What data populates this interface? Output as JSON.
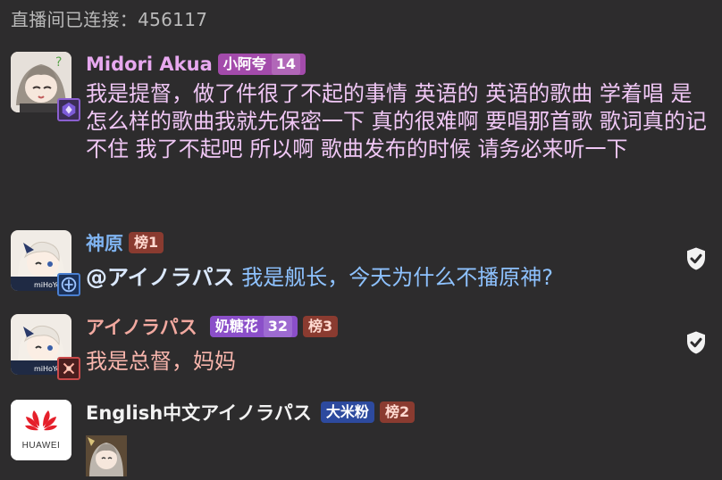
{
  "header": {
    "connected": "直播间已连接：456117"
  },
  "messages": [
    {
      "username": "Midori Akua",
      "badges": [
        {
          "label": "小阿夸",
          "level": "14"
        }
      ],
      "text": "我是提督，做了件很了不起的事情 英语的 英语的歌曲 学着唱 是怎么样的歌曲我就先保密一下 真的很难啊 要唱那首歌 歌词真的记不住 我了不起吧 所以啊 歌曲发布的时候 请务必来听一下",
      "colors": {
        "name": "#e7a8ef",
        "text": "#f0c7f5",
        "badge": "#a34bab"
      },
      "avatar": "anime-girl-avatar"
    },
    {
      "username": "神原",
      "badges": [
        {
          "label": "榜1"
        }
      ],
      "mention": "@アイノラパス",
      "text": "我是舰长，今天为什么不播原神?",
      "colors": {
        "name": "#7fb3f0",
        "text": "#8ec2ff",
        "badge": "#8a3b30"
      },
      "avatar": "genshin-paimon-avatar",
      "verified": "shield-check-icon"
    },
    {
      "username": "アイノラパス",
      "badges": [
        {
          "label": "奶糖花",
          "level": "32"
        },
        {
          "label": "榜3"
        }
      ],
      "text": "我是总督，妈妈",
      "colors": {
        "name": "#f2a9a0",
        "text": "#f9b6ad",
        "badge": "#8b4fc9",
        "badge2": "#8a3b30"
      },
      "avatar": "genshin-paimon-avatar",
      "verified": "shield-check-icon"
    },
    {
      "username": "English中文アイノラパス",
      "badges": [
        {
          "label": "大米粉"
        },
        {
          "label": "榜2"
        }
      ],
      "colors": {
        "name": "#f2f2f2",
        "badge": "#2d4a9e",
        "badge2": "#8a3b30"
      },
      "avatar": "huawei-logo-avatar",
      "avatar_label": "HUAWEI",
      "sticker": "sticker-image"
    }
  ]
}
